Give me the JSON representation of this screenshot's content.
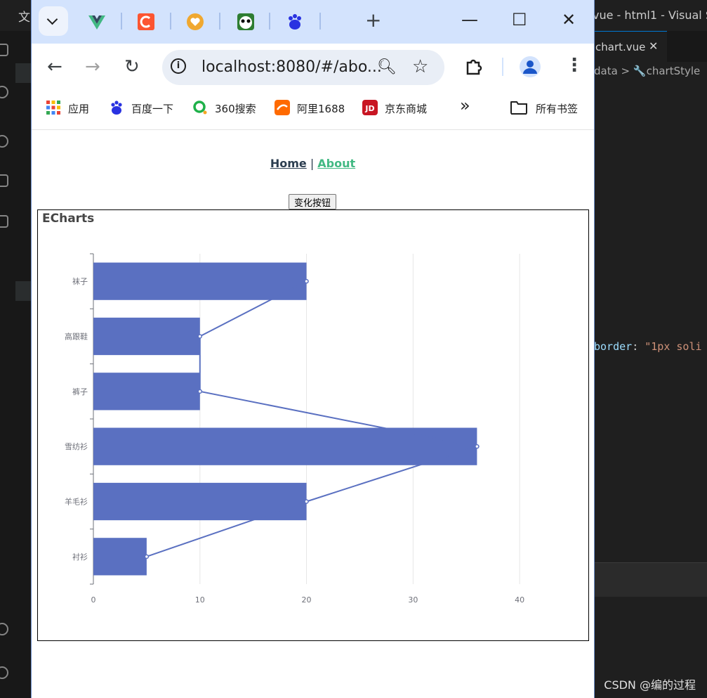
{
  "vscode": {
    "menu_left": "文",
    "window_title": "vue - html1 - Visual S",
    "tab_name": "chart.vue",
    "tab_close": "✕",
    "breadcrumb": "data > ",
    "breadcrumb_item": "chartStyle",
    "code_key": "border",
    "code_punct": ": ",
    "code_value": "\"1px soli"
  },
  "watermark": "CSDN @编的过程",
  "browser": {
    "window_buttons": {
      "minimize": "—",
      "maximize": "☐",
      "close": "✕"
    },
    "new_tab": "+",
    "address": "localhost:8080/#/abo...",
    "bookmarks": [
      {
        "label": "应用",
        "color": "#e8453c"
      },
      {
        "label": "百度一下",
        "color": "#2932e1"
      },
      {
        "label": "360搜索",
        "color": "#1fb14a"
      },
      {
        "label": "阿里1688",
        "color": "#ff6a00"
      },
      {
        "label": "京东商城",
        "color": "#c81623"
      }
    ],
    "bookmarks_more": "»",
    "all_bookmarks": "所有书签"
  },
  "page": {
    "nav_home": "Home",
    "nav_sep": " | ",
    "nav_about": "About",
    "change_button": "变化按钮"
  },
  "chart_data": {
    "type": "bar",
    "title": "ECharts",
    "orientation": "horizontal",
    "categories": [
      "衬衫",
      "羊毛衫",
      "雪纺衫",
      "裤子",
      "高跟鞋",
      "袜子"
    ],
    "series": [
      {
        "type": "bar",
        "values": [
          5,
          20,
          36,
          10,
          10,
          20
        ],
        "color": "#5a70c1"
      },
      {
        "type": "line",
        "values": [
          5,
          20,
          36,
          10,
          10,
          20
        ],
        "color": "#5a70c1"
      }
    ],
    "xlim": [
      0,
      45
    ],
    "xticks": [
      0,
      10,
      20,
      30,
      40
    ],
    "grid": true
  }
}
